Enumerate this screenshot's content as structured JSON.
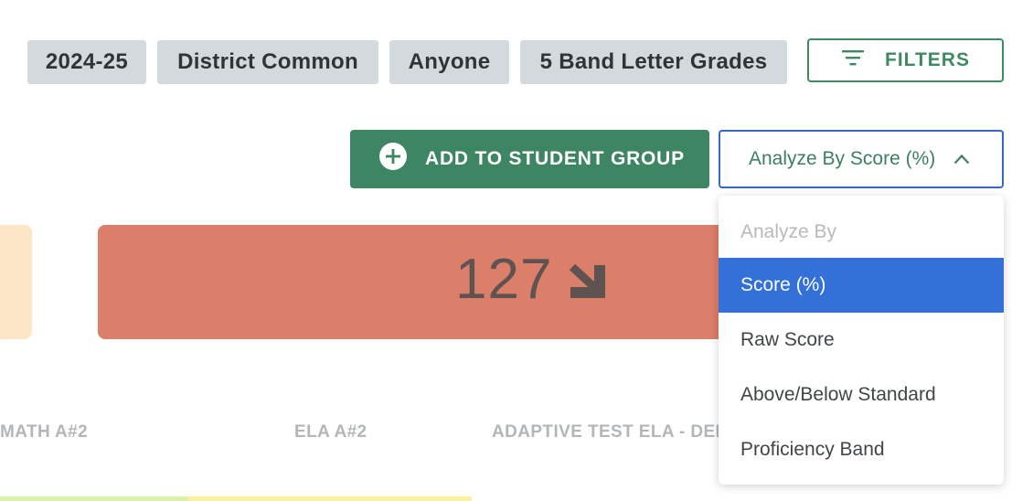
{
  "filter_chips": [
    "2024-25",
    "District Common",
    "Anyone",
    "5 Band Letter Grades"
  ],
  "filters_button": {
    "label": "FILTERS",
    "icon": "filter-lines-icon",
    "color": "#3f8a63"
  },
  "add_button": {
    "label": "ADD TO STUDENT GROUP",
    "icon": "plus-circle-icon",
    "color": "#3e8563"
  },
  "analyze_button": {
    "label": "Analyze By Score (%)",
    "icon": "chevron-up-icon"
  },
  "dropdown": {
    "header": "Analyze By",
    "options": [
      "Score (%)",
      "Raw Score",
      "Above/Below Standard",
      "Proficiency Band"
    ],
    "selected": "Score (%)",
    "selected_color": "#3370d8"
  },
  "tile": {
    "value": "127",
    "icon": "arrow-down-right-icon",
    "color": "#db7e6a"
  },
  "columns": [
    "MATH A#2",
    "ELA A#2",
    "ADAPTIVE TEST ELA - DEM"
  ]
}
